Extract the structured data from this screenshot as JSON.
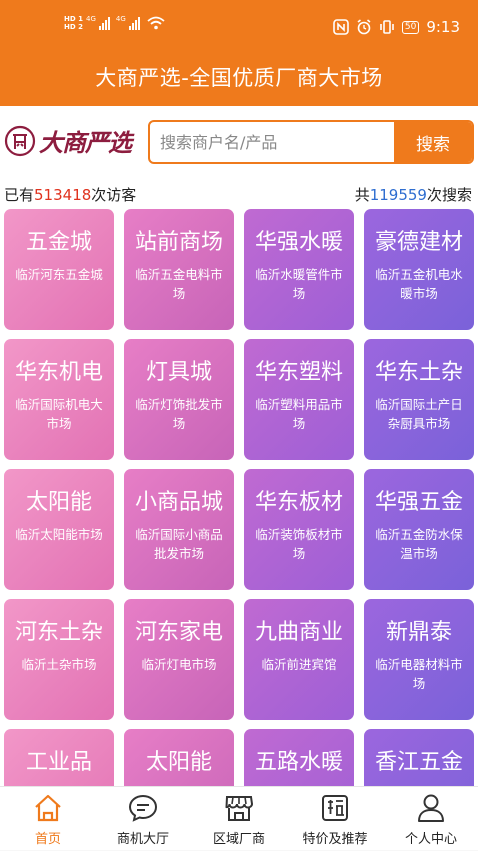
{
  "status_bar": {
    "left_tags": [
      "HD 1",
      "HD 2"
    ],
    "network_1": "4G",
    "network_2": "4G",
    "battery": "50",
    "time": "9:13"
  },
  "app": {
    "title": "大商严选-全国优质厂商大市场"
  },
  "logo": {
    "text": "大商严选"
  },
  "search": {
    "placeholder": "搜索商户名/产品",
    "button": "搜索"
  },
  "stats": {
    "visitors_prefix": "已有",
    "visitors_count": "513418",
    "visitors_suffix": "次访客",
    "searches_prefix": "共",
    "searches_count": "119559",
    "searches_suffix": "次搜索"
  },
  "markets": [
    {
      "name": "五金城",
      "desc": "临沂河东五金城"
    },
    {
      "name": "站前商场",
      "desc": "临沂五金电料市场"
    },
    {
      "name": "华强水暖",
      "desc": "临沂水暖管件市场"
    },
    {
      "name": "豪德建材",
      "desc": "临沂五金机电水暖市场"
    },
    {
      "name": "华东机电",
      "desc": "临沂国际机电大市场"
    },
    {
      "name": "灯具城",
      "desc": "临沂灯饰批发市场"
    },
    {
      "name": "华东塑料",
      "desc": "临沂塑料用品市场"
    },
    {
      "name": "华东土杂",
      "desc": "临沂国际土产日杂厨具市场"
    },
    {
      "name": "太阳能",
      "desc": "临沂太阳能市场"
    },
    {
      "name": "小商品城",
      "desc": "临沂国际小商品批发市场"
    },
    {
      "name": "华东板材",
      "desc": "临沂装饰板材市场"
    },
    {
      "name": "华强五金",
      "desc": "临沂五金防水保温市场"
    },
    {
      "name": "河东土杂",
      "desc": "临沂土杂市场"
    },
    {
      "name": "河东家电",
      "desc": "临沂灯电市场"
    },
    {
      "name": "九曲商业",
      "desc": "临沂前进宾馆"
    },
    {
      "name": "新鼎泰",
      "desc": "临沂电器材料市场"
    },
    {
      "name": "工业品",
      "desc": ""
    },
    {
      "name": "太阳能",
      "desc": ""
    },
    {
      "name": "五路水暖",
      "desc": ""
    },
    {
      "name": "香江五金",
      "desc": ""
    }
  ],
  "tabs": [
    {
      "label": "首页",
      "icon": "home-icon",
      "active": true
    },
    {
      "label": "商机大厅",
      "icon": "chat-icon",
      "active": false
    },
    {
      "label": "区域厂商",
      "icon": "store-icon",
      "active": false
    },
    {
      "label": "特价及推荐",
      "icon": "price-tag-icon",
      "active": false
    },
    {
      "label": "个人中心",
      "icon": "user-icon",
      "active": false
    }
  ],
  "colors": {
    "accent": "#ef7a1c",
    "count_red": "#e0321e",
    "count_blue": "#2f6ed0",
    "logo": "#8d1d3f"
  }
}
